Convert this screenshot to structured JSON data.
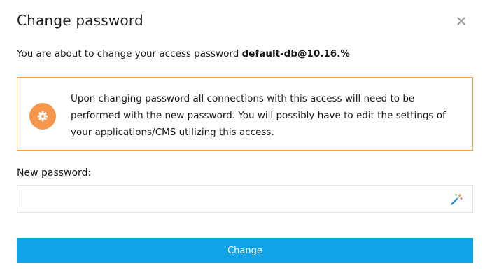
{
  "dialog": {
    "title": "Change password",
    "close_icon": "close-icon"
  },
  "intro": {
    "text": "You are about to change your access password ",
    "access_name": "default-db@10.16.%"
  },
  "notice": {
    "icon": "gear-icon",
    "icon_color": "#f5964a",
    "border_color": "#f0a050",
    "text": "Upon changing password all connections with this access will need to be performed with the new password. You will possibly have to edit the settings of your applications/CMS utilizing this access."
  },
  "new_password": {
    "label": "New password:",
    "value": "",
    "placeholder": "",
    "generate_icon": "magic-wand-icon"
  },
  "submit": {
    "label": "Change",
    "color": "#12a3e6"
  }
}
